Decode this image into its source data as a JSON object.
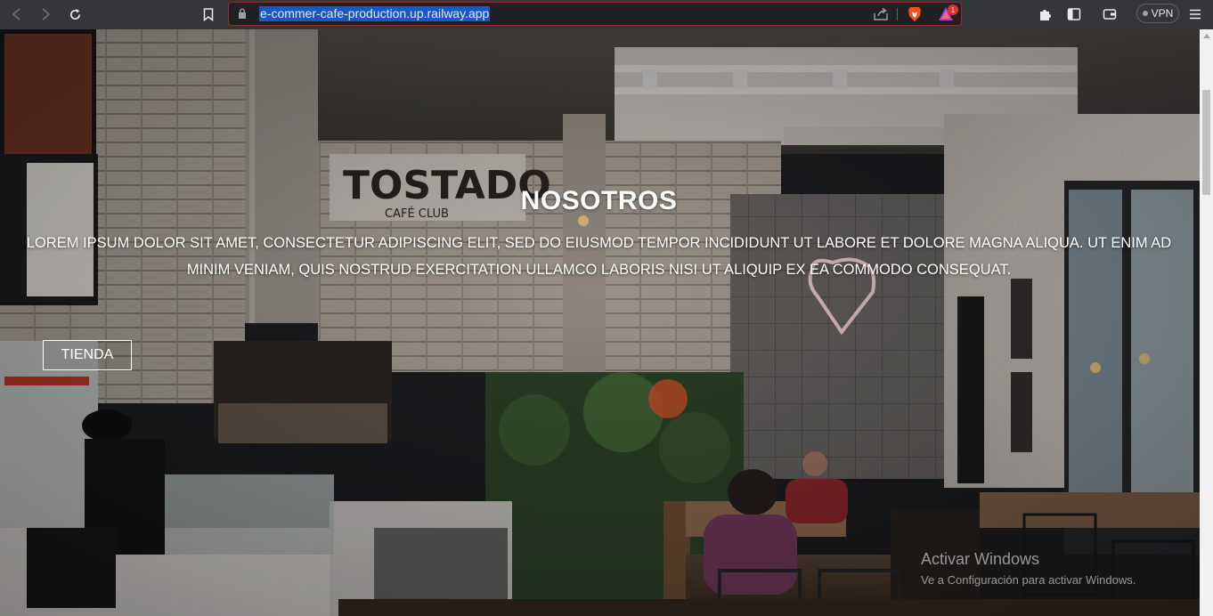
{
  "browser": {
    "url": "e-commer-cafe-production.up.railway.app",
    "rewards_badge": "1",
    "vpn_label": "VPN"
  },
  "hero": {
    "title": "NOSOTROS",
    "body": "LOREM IPSUM DOLOR SIT AMET, CONSECTETUR ADIPISCING ELIT, SED DO EIUSMOD TEMPOR INCIDIDUNT UT LABORE ET DOLORE MAGNA ALIQUA. UT ENIM AD MINIM VENIAM, QUIS NOSTRUD EXERCITATION ULLAMCO LABORIS NISI UT ALIQUIP EX EA COMMODO CONSEQUAT.",
    "button_label": "TIENDA",
    "photo_sign_name": "TOSTADO",
    "photo_sign_sub": "CAFÉ CLUB"
  },
  "watermark": {
    "line1": "Activar Windows",
    "line2": "Ve a Configuración para activar Windows."
  },
  "colors": {
    "chrome_bg": "#35363a",
    "url_highlight": "#1a56c7",
    "urlbar_border": "#8b2f2f"
  }
}
